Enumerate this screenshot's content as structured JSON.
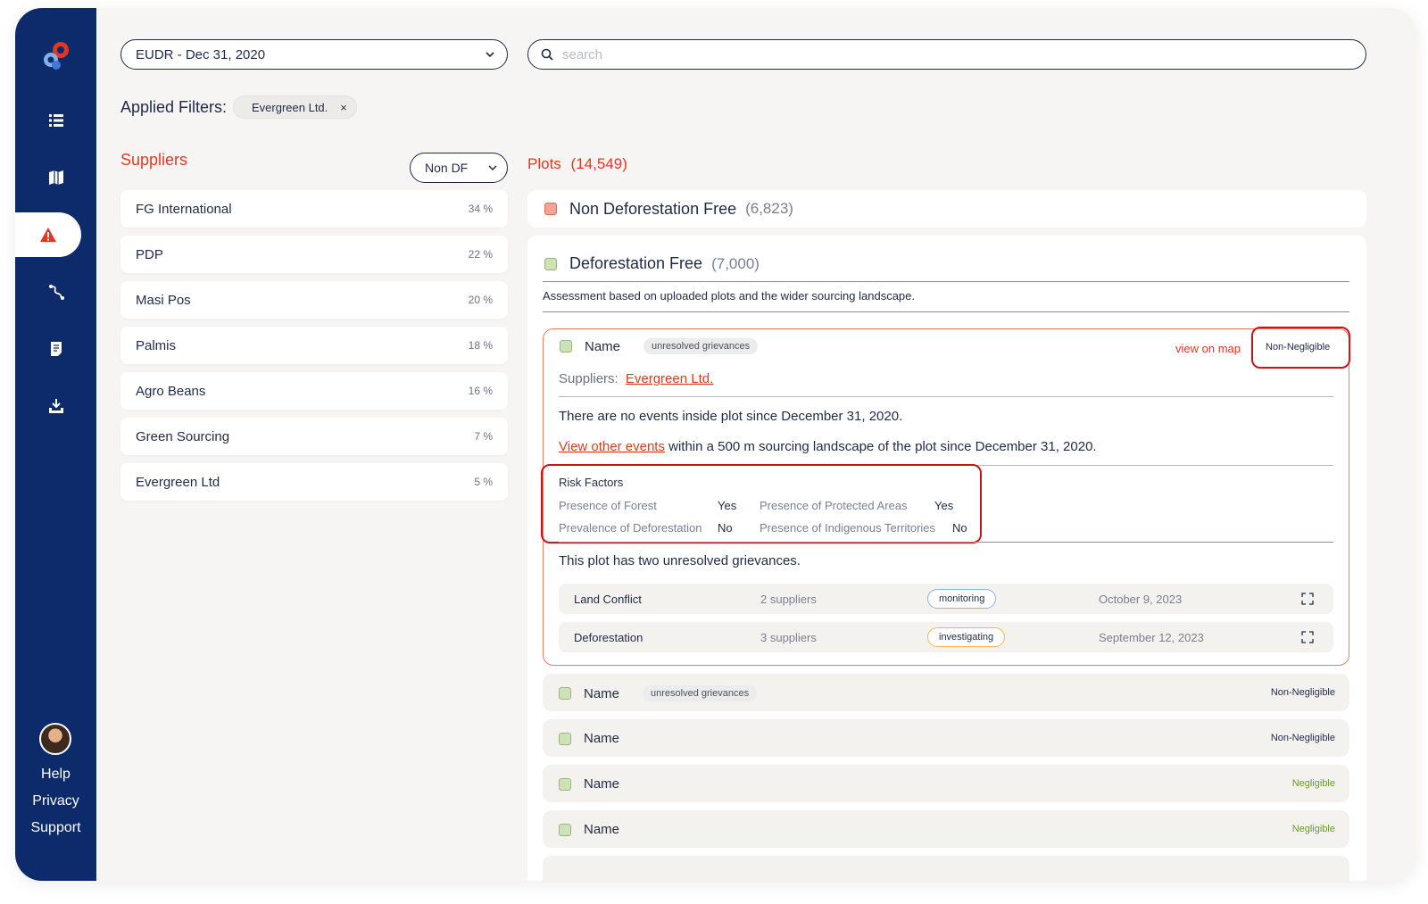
{
  "sidebar": {
    "nav": [
      {
        "icon": "list-icon"
      },
      {
        "icon": "map-book-icon"
      },
      {
        "icon": "warning-icon",
        "active": true
      },
      {
        "icon": "route-icon"
      },
      {
        "icon": "document-icon"
      },
      {
        "icon": "download-icon"
      }
    ],
    "links": {
      "help": "Help",
      "privacy": "Privacy",
      "support": "Support"
    }
  },
  "header": {
    "regulation_select": "EUDR -  Dec 31, 2020",
    "search_placeholder": "search",
    "applied_filters_label": "Applied Filters:",
    "filter_chips": [
      {
        "label": "Evergreen Ltd.",
        "remove": "×"
      }
    ]
  },
  "suppliers": {
    "title": "Suppliers",
    "filter_select": "Non DF",
    "items": [
      {
        "name": "FG International",
        "pct": "34 %"
      },
      {
        "name": "PDP",
        "pct": "22 %"
      },
      {
        "name": "Masi Pos",
        "pct": "20 %"
      },
      {
        "name": "Palmis",
        "pct": "18 %"
      },
      {
        "name": "Agro Beans",
        "pct": "16 %"
      },
      {
        "name": "Green Sourcing",
        "pct": "7 %"
      },
      {
        "name": "Evergreen Ltd",
        "pct": "5 %"
      }
    ]
  },
  "plots": {
    "title": "Plots",
    "count": "(14,549)",
    "groups": [
      {
        "label": "Non Deforestation Free",
        "count": "(6,823)"
      },
      {
        "label": "Deforestation Free",
        "count": "(7,000)"
      }
    ],
    "assessment_note": "Assessment based on uploaded plots and the wider sourcing landscape.",
    "expanded": {
      "name": "Name",
      "tag": "unresolved grievances",
      "view_on_map": "view on map",
      "risk": "Non-Negligible",
      "suppliers_label": "Suppliers:",
      "supplier_link": "Evergreen Ltd.",
      "events_text": "There are no events inside plot since December 31, 2020.",
      "other_events_link": "View other events",
      "other_events_rest": " within a 500 m sourcing landscape of the plot since December 31, 2020.",
      "risk_factors_title": "Risk Factors",
      "risk_factors": [
        {
          "label": "Presence of Forest",
          "value": "Yes"
        },
        {
          "label": "Presence of Protected Areas",
          "value": "Yes"
        },
        {
          "label": "Prevalence of Deforestation",
          "value": "No"
        },
        {
          "label": "Presence of Indigenous Territories",
          "value": "No"
        }
      ],
      "grievance_summary": "This plot has two unresolved grievances.",
      "grievances": [
        {
          "type": "Land Conflict",
          "suppliers": "2 suppliers",
          "status": "monitoring",
          "date": "October 9, 2023"
        },
        {
          "type": "Deforestation",
          "suppliers": "3 suppliers",
          "status": "investigating",
          "date": "September 12, 2023"
        }
      ]
    },
    "rows": [
      {
        "name": "Name",
        "tag": "unresolved grievances",
        "risk": "Non-Negligible"
      },
      {
        "name": "Name",
        "tag": "",
        "risk": "Non-Negligible"
      },
      {
        "name": "Name",
        "tag": "",
        "risk": "Negligible"
      },
      {
        "name": "Name",
        "tag": "",
        "risk": "Negligible"
      }
    ]
  },
  "colors": {
    "sidebar": "#0d2a6b",
    "accent": "#e0391f",
    "highlight": "#c8151c",
    "negligible": "#6a9a2a",
    "non_negligible": "#1f2a44",
    "monitoring": "#8ab4e6",
    "investigating": "#f2b84b"
  }
}
